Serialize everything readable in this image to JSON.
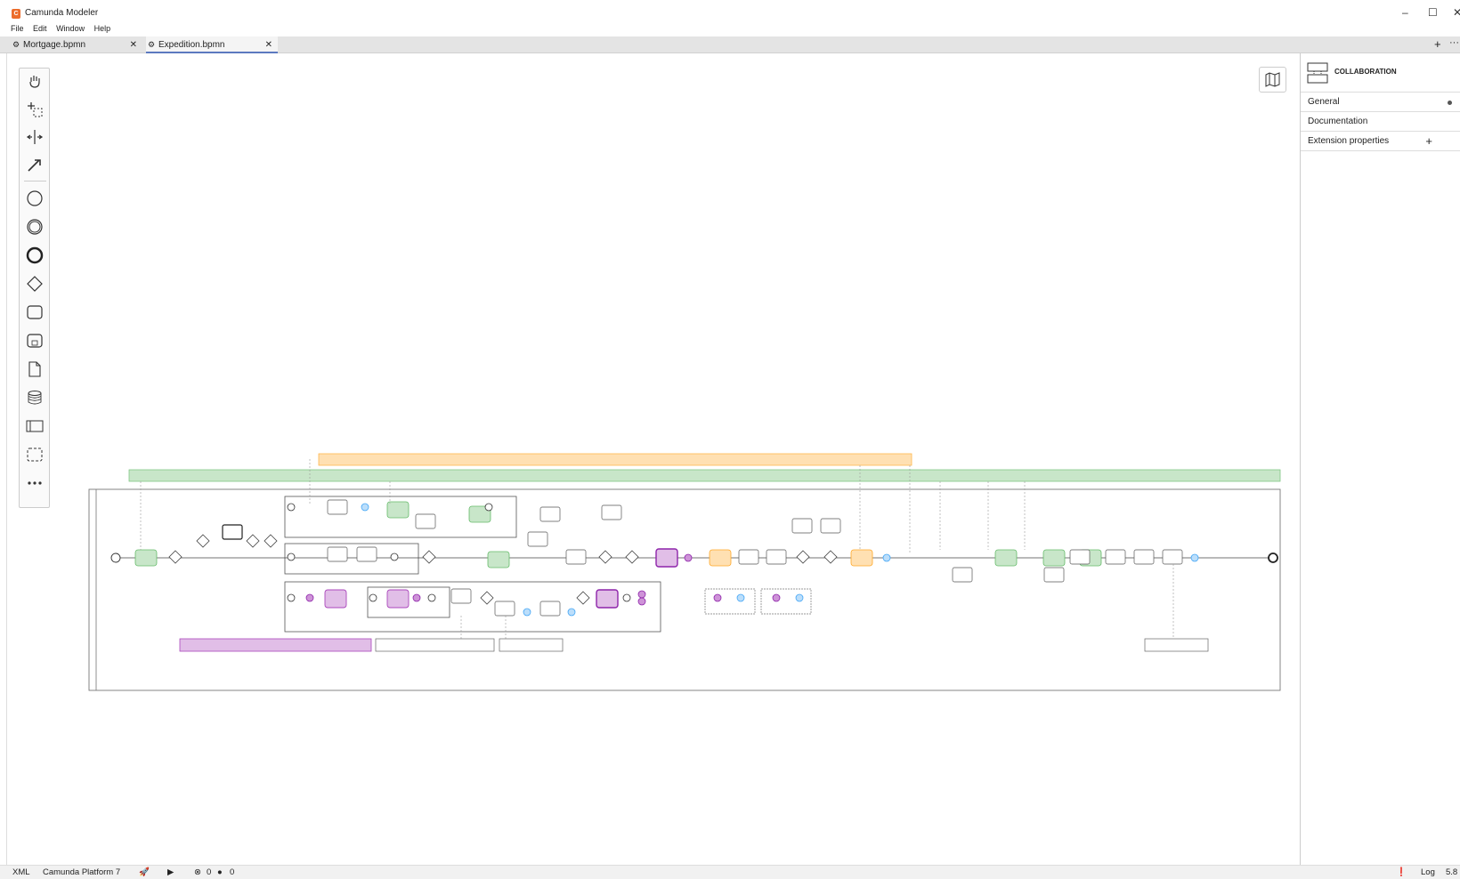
{
  "app": {
    "title": "Camunda Modeler",
    "logo_color": "#ec6d2c"
  },
  "window_controls": {
    "minimize": "–",
    "maximize": "☐",
    "close": "✕"
  },
  "menu": [
    "File",
    "Edit",
    "Window",
    "Help"
  ],
  "tabs": [
    {
      "label": "Mortgage.bpmn",
      "active": false
    },
    {
      "label": "Expedition.bpmn",
      "active": true
    }
  ],
  "palette_tools": [
    "hand-tool-icon",
    "lasso-tool-icon",
    "space-tool-icon",
    "connect-tool-icon",
    "start-event-icon",
    "intermediate-event-icon",
    "end-event-icon",
    "gateway-icon",
    "task-icon",
    "subprocess-icon",
    "data-object-icon",
    "data-store-icon",
    "pool-icon",
    "group-icon",
    "more-icon"
  ],
  "properties": {
    "element_type": "COLLABORATION",
    "groups": [
      {
        "label": "General",
        "has_dot": true
      },
      {
        "label": "Documentation"
      },
      {
        "label": "Extension properties",
        "has_plus": true
      }
    ]
  },
  "statusbar": {
    "xml": "XML",
    "platform": "Camunda Platform 7",
    "errors": "0",
    "warnings": "0",
    "log": "Log",
    "version": "5.8"
  },
  "colors": {
    "green_task": "#c8e6c9",
    "purple_task": "#e1bee7",
    "orange_task": "#ffe0b2",
    "blue_event": "#bbdefb",
    "accent": "#5c79c0"
  }
}
